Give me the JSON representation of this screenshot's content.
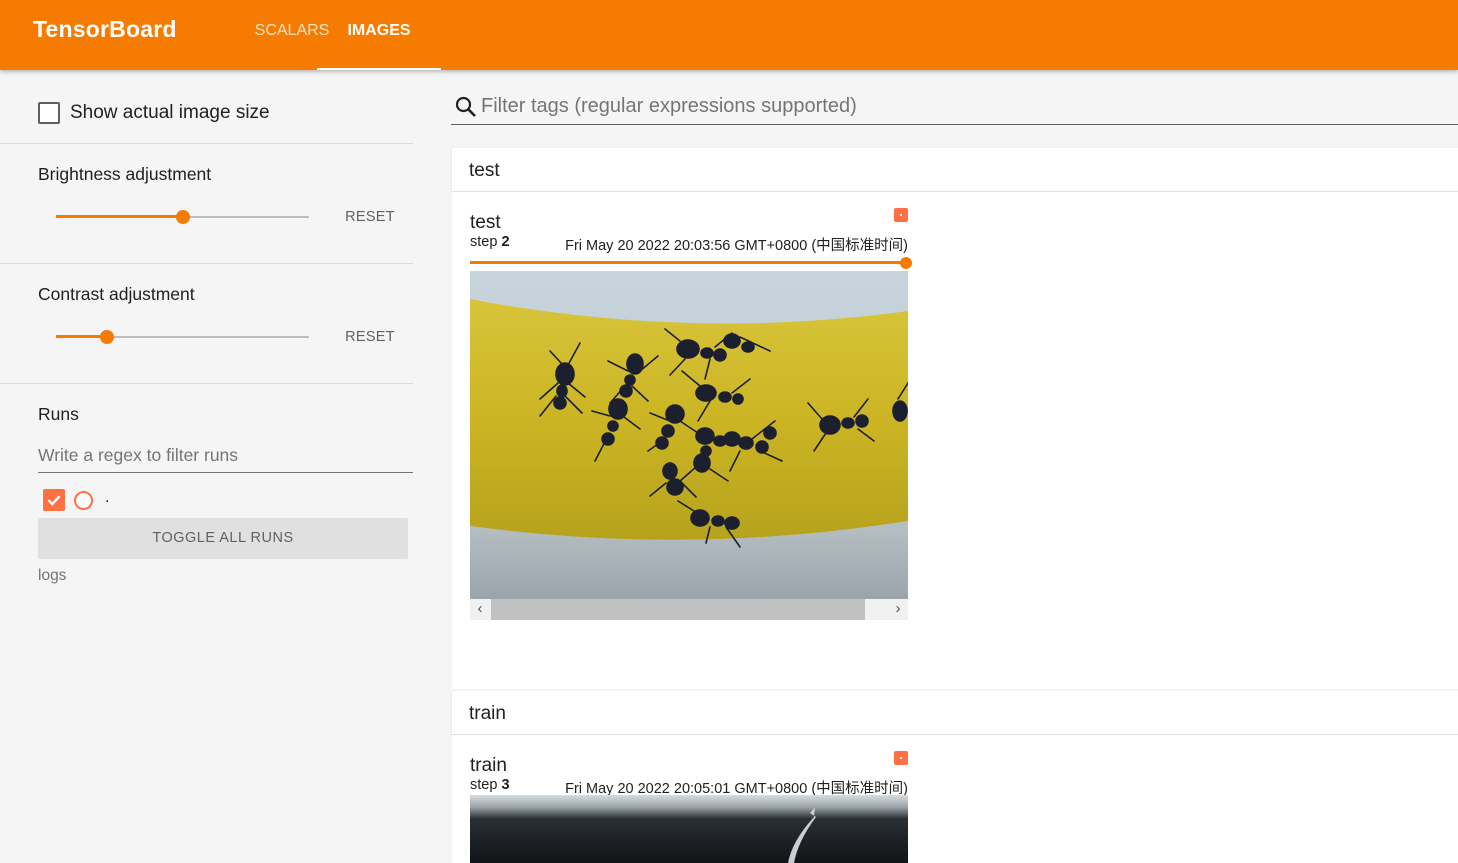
{
  "header": {
    "brand": "TensorBoard",
    "tabs": [
      {
        "label": "SCALARS",
        "active": false
      },
      {
        "label": "IMAGES",
        "active": true
      }
    ],
    "accent_color": "#f57c00"
  },
  "sidebar": {
    "show_actual_size": {
      "label": "Show actual image size",
      "checked": false
    },
    "brightness": {
      "title": "Brightness adjustment",
      "value_fraction": 0.5,
      "reset_label": "RESET"
    },
    "contrast": {
      "title": "Contrast adjustment",
      "value_fraction": 0.2,
      "reset_label": "RESET"
    },
    "runs": {
      "title": "Runs",
      "filter_placeholder": "Write a regex to filter runs",
      "items": [
        {
          "name": ".",
          "checked": true,
          "color": "#ff7043"
        }
      ],
      "toggle_label": "TOGGLE ALL RUNS",
      "logdir": "logs"
    }
  },
  "main": {
    "filter_placeholder": "Filter tags (regular expressions supported)",
    "groups": [
      {
        "name": "test",
        "card": {
          "tag": "test",
          "step_label": "step",
          "step": "2",
          "timestamp": "Fri May 20 2022 20:03:56 GMT+0800 (中国标准时间)",
          "step_fraction": 1.0,
          "image_icon": "ants-on-yellow-image"
        }
      },
      {
        "name": "train",
        "card": {
          "tag": "train",
          "step_label": "step",
          "step": "3",
          "timestamp": "Fri May 20 2022 20:05:01 GMT+0800 (中国标准时间)",
          "image_icon": "dark-photo-image"
        }
      }
    ]
  }
}
